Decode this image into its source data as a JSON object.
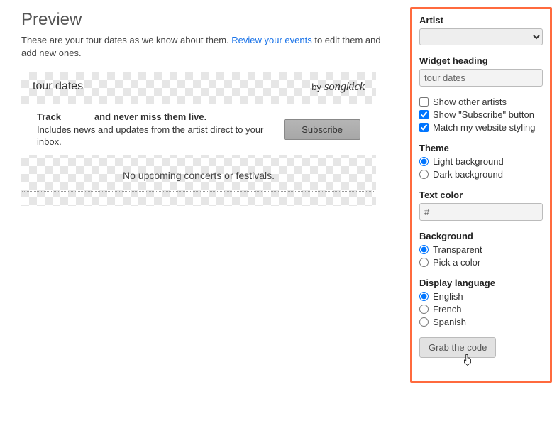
{
  "preview": {
    "title": "Preview",
    "desc_a": "These are your tour dates as we know about them. ",
    "review_link": "Review your events",
    "desc_b": " to edit them and add new ones."
  },
  "widget": {
    "heading_text": "tour dates",
    "by_label": "by",
    "brand": "songkick",
    "track_prefix": "Track ",
    "track_suffix": " and never miss them live.",
    "subline": "Includes news and updates from the artist direct to your inbox.",
    "subscribe": "Subscribe",
    "empty": "No upcoming concerts or festivals."
  },
  "form": {
    "artist_label": "Artist",
    "artist_value": "",
    "heading_label": "Widget heading",
    "heading_value": "tour dates",
    "show_other": "Show other artists",
    "show_subscribe": "Show \"Subscribe\" button",
    "match_styling": "Match my website styling",
    "theme_label": "Theme",
    "theme_light": "Light background",
    "theme_dark": "Dark background",
    "textcolor_label": "Text color",
    "textcolor_value": "#",
    "bg_label": "Background",
    "bg_transparent": "Transparent",
    "bg_pick": "Pick a color",
    "lang_label": "Display language",
    "lang_en": "English",
    "lang_fr": "French",
    "lang_es": "Spanish",
    "grab": "Grab the code"
  }
}
